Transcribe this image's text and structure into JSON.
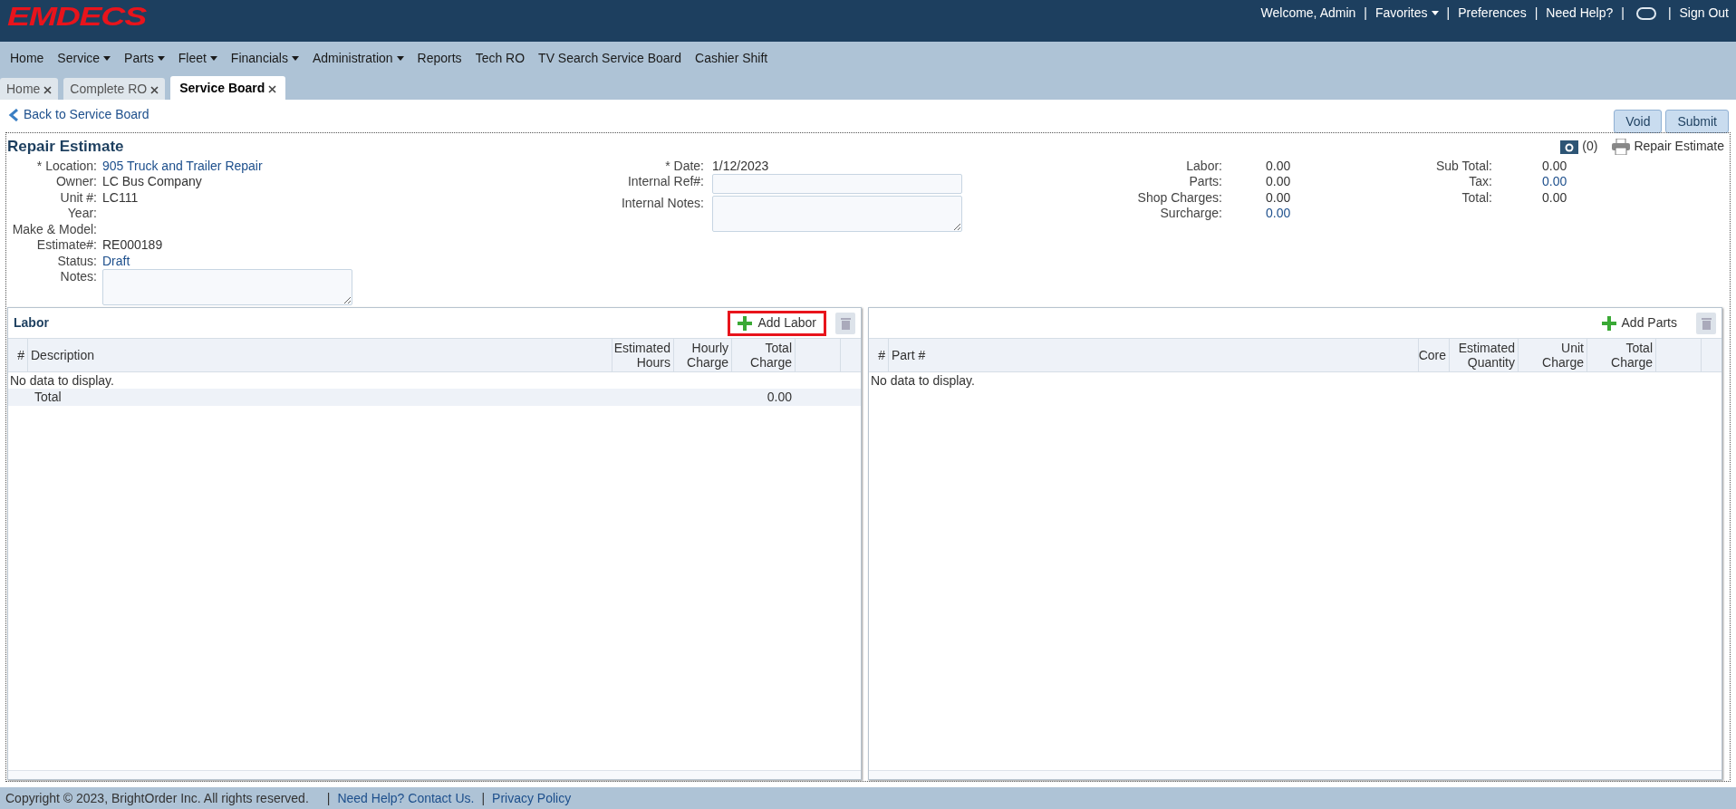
{
  "header": {
    "logo": "EMDECS",
    "separator": "|",
    "links": [
      {
        "kind": "text",
        "label": "Welcome, Admin",
        "has_menu": false
      },
      {
        "kind": "text",
        "label": "Favorites",
        "has_menu": true
      },
      {
        "kind": "text",
        "label": "Preferences",
        "has_menu": false
      },
      {
        "kind": "text",
        "label": "Need Help?",
        "has_menu": false
      },
      {
        "kind": "icon"
      },
      {
        "kind": "text",
        "label": "Sign Out",
        "has_menu": false
      }
    ]
  },
  "menu": [
    {
      "label": "Home",
      "has_menu": false
    },
    {
      "label": "Service",
      "has_menu": true
    },
    {
      "label": "Parts",
      "has_menu": true
    },
    {
      "label": "Fleet",
      "has_menu": true
    },
    {
      "label": "Financials",
      "has_menu": true
    },
    {
      "label": "Administration",
      "has_menu": true
    },
    {
      "label": "Reports",
      "has_menu": false
    },
    {
      "label": "Tech RO",
      "has_menu": false
    },
    {
      "label": "TV Search Service Board",
      "has_menu": false
    },
    {
      "label": "Cashier Shift",
      "has_menu": false
    }
  ],
  "tabs": [
    {
      "label": "Home",
      "selected": false
    },
    {
      "label": "Complete RO",
      "selected": false
    },
    {
      "label": "Service Board",
      "selected": true
    }
  ],
  "back_link": "Back to Service Board",
  "actions": [
    "Void",
    "Submit"
  ],
  "title": "Repair Estimate",
  "photos": {
    "count": "(0)"
  },
  "print": {
    "label": "Repair Estimate"
  },
  "details": [
    {
      "label": "* Location:",
      "kind": "link",
      "value": "905 Truck and Trailer Repair"
    },
    {
      "label": "Owner:",
      "kind": "text",
      "value": "LC Bus Company"
    },
    {
      "label": "Unit #:",
      "kind": "text",
      "value": "LC111"
    },
    {
      "label": "Year:",
      "kind": "text"
    },
    {
      "label": "Make & Model:",
      "kind": "text"
    },
    {
      "label": "Estimate#:",
      "kind": "text",
      "value": "RE000189"
    },
    {
      "label": "Status:",
      "kind": "link",
      "value": "Draft"
    },
    {
      "label": "Notes:",
      "kind": "textarea"
    }
  ],
  "internal": [
    {
      "label": "* Date:",
      "kind": "text",
      "value": "1/12/2023"
    },
    {
      "label": "Internal Ref#:",
      "kind": "input"
    },
    {
      "label": "Internal Notes:",
      "kind": "textarea"
    }
  ],
  "charges": [
    {
      "label": "Labor:",
      "kind": "text",
      "value": "0.00"
    },
    {
      "label": "Parts:",
      "kind": "text",
      "value": "0.00"
    },
    {
      "label": "Shop Charges:",
      "kind": "text",
      "value": "0.00"
    },
    {
      "label": "Surcharge:",
      "kind": "link",
      "value": "0.00"
    }
  ],
  "totals": [
    {
      "label": "Sub Total:",
      "kind": "text",
      "value": "0.00"
    },
    {
      "label": "Tax:",
      "kind": "link",
      "value": "0.00"
    },
    {
      "label": "Total:",
      "kind": "text",
      "value": "0.00"
    }
  ],
  "labor": {
    "title": "Labor",
    "add_button": {
      "label": "Add Labor",
      "highlighted": true
    },
    "columns": [
      "#",
      "Description",
      "Estimated Hours",
      "Hourly Charge",
      "Total Charge"
    ],
    "empty": "No data to display.",
    "total_row": {
      "label": "Total",
      "amount": "0.00"
    }
  },
  "parts": {
    "add_button": {
      "label": "Add Parts",
      "highlighted": false
    },
    "columns": [
      "#",
      "Part #",
      "Core",
      "Estimated Quantity",
      "Unit Charge",
      "Total Charge"
    ],
    "empty": "No data to display."
  },
  "footer": {
    "copyright": "Copyright © 2023, BrightOrder Inc. All rights reserved.",
    "separator": "|",
    "links": [
      "Need Help? Contact Us.",
      "Privacy Policy"
    ]
  }
}
